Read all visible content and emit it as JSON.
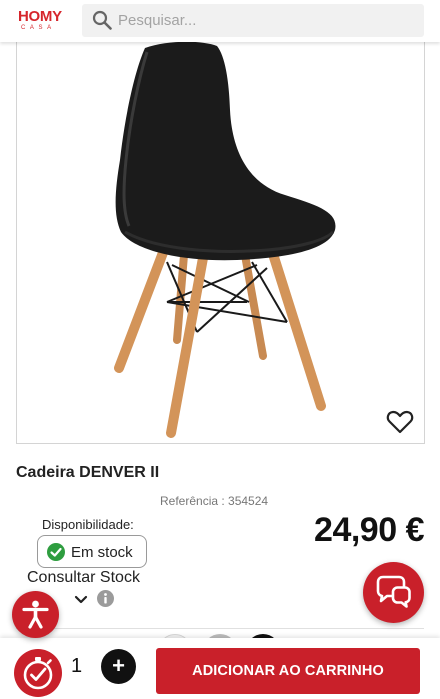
{
  "header": {
    "logo_main": "HOMY",
    "logo_sub": "CASA",
    "search_placeholder": "Pesquisar..."
  },
  "product": {
    "name": "Cadeira DENVER II",
    "reference": "Referência : 354524",
    "availability_label": "Disponibilidade:",
    "stock_status": "Em stock",
    "consult_stock": "Consultar Stock",
    "price": "24,90 €",
    "image_icon": "chair-photo",
    "favorite_icon": "heart-icon"
  },
  "cart": {
    "quantity": "1",
    "plus_label": "+",
    "add_to_cart": "ADICIONAR AO CARRINHO"
  },
  "colors": {
    "brand": "#c9202a",
    "stock_ok": "#2e9d3f",
    "text": "#1a1a1a",
    "price": "#111111"
  }
}
